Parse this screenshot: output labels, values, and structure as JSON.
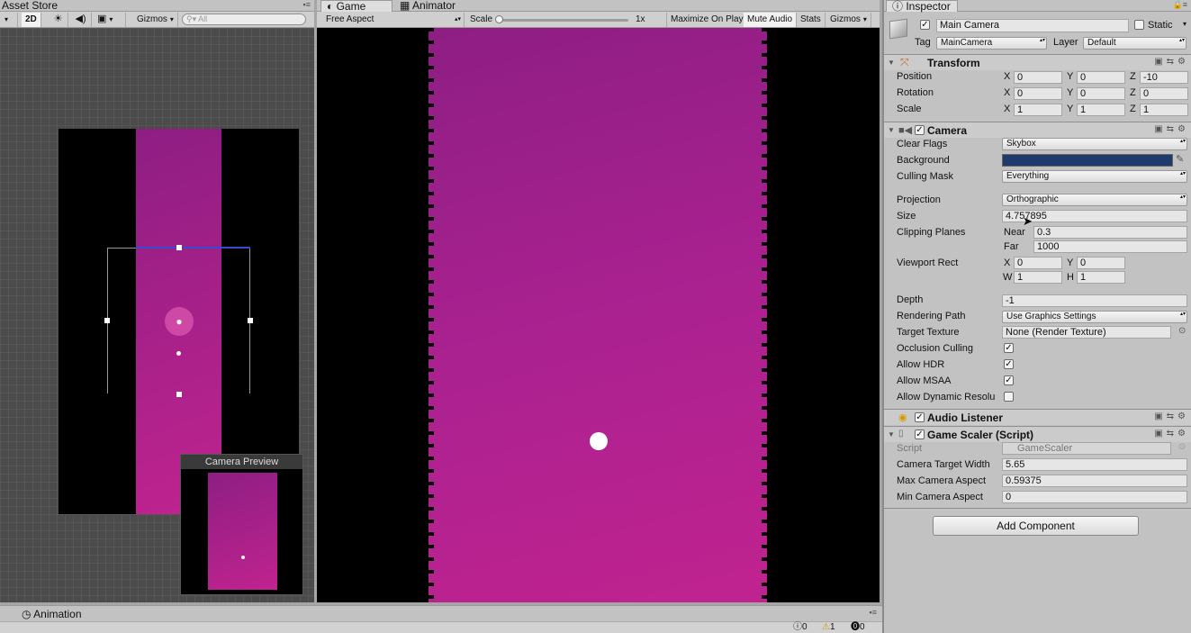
{
  "scene_panel": {
    "tab_asset_store": "Asset Store",
    "btn_2d": "2D",
    "gizmos": "Gizmos",
    "search_placeholder": "All",
    "camera_preview_title": "Camera Preview"
  },
  "game_panel": {
    "tab_game": "Game",
    "tab_animator": "Animator",
    "aspect": "Free Aspect",
    "scale_label": "Scale",
    "scale_value": "1x",
    "maximize": "Maximize On Play",
    "mute": "Mute Audio",
    "stats": "Stats",
    "gizmos": "Gizmos"
  },
  "bottom": {
    "tab_animation": "Animation",
    "count_info": "0",
    "count_warn": "1",
    "count_error": "0"
  },
  "inspector": {
    "tab_label": "Inspector",
    "object_name": "Main Camera",
    "static_label": "Static",
    "tag_label": "Tag",
    "tag_value": "MainCamera",
    "layer_label": "Layer",
    "layer_value": "Default",
    "transform": {
      "title": "Transform",
      "position_label": "Position",
      "rotation_label": "Rotation",
      "scale_label": "Scale",
      "position": {
        "x": "0",
        "y": "0",
        "z": "-10"
      },
      "rotation": {
        "x": "0",
        "y": "0",
        "z": "0"
      },
      "scale": {
        "x": "1",
        "y": "1",
        "z": "1"
      }
    },
    "camera": {
      "title": "Camera",
      "clear_flags_label": "Clear Flags",
      "clear_flags_value": "Skybox",
      "background_label": "Background",
      "background_color": "#1f3a6b",
      "culling_mask_label": "Culling Mask",
      "culling_mask_value": "Everything",
      "projection_label": "Projection",
      "projection_value": "Orthographic",
      "size_label": "Size",
      "size_value": "4.757895",
      "clipping_label": "Clipping Planes",
      "near_label": "Near",
      "near_value": "0.3",
      "far_label": "Far",
      "far_value": "1000",
      "viewport_label": "Viewport Rect",
      "vp_x": "0",
      "vp_y": "0",
      "vp_w": "1",
      "vp_h": "1",
      "depth_label": "Depth",
      "depth_value": "-1",
      "rendering_path_label": "Rendering Path",
      "rendering_path_value": "Use Graphics Settings",
      "target_texture_label": "Target Texture",
      "target_texture_value": "None (Render Texture)",
      "occlusion_label": "Occlusion Culling",
      "hdr_label": "Allow HDR",
      "msaa_label": "Allow MSAA",
      "dynamic_label": "Allow Dynamic Resolu"
    },
    "audio_listener": {
      "title": "Audio Listener"
    },
    "game_scaler": {
      "title": "Game Scaler (Script)",
      "script_label": "Script",
      "script_value": "GameScaler",
      "target_width_label": "Camera Target Width",
      "target_width_value": "5.65",
      "max_aspect_label": "Max Camera Aspect",
      "max_aspect_value": "0.59375",
      "min_aspect_label": "Min Camera Aspect",
      "min_aspect_value": "0"
    },
    "add_component": "Add Component"
  },
  "colors": {
    "accent_magenta": "#c0238f",
    "dark_magenta": "#8e1e83"
  }
}
